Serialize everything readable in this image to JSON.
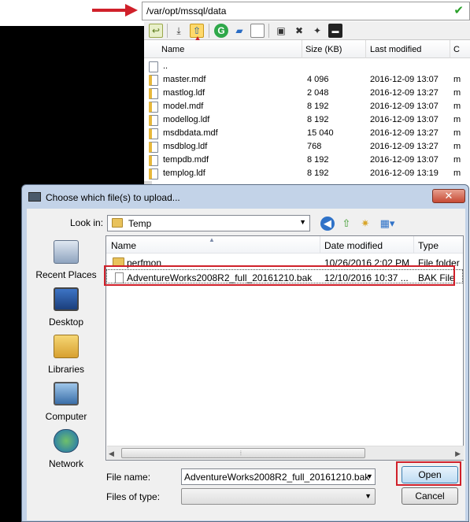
{
  "remote": {
    "path": "/var/opt/mssql/data",
    "columns": [
      "Name",
      "Size (KB)",
      "Last modified",
      "C"
    ],
    "parent_label": "..",
    "files": [
      {
        "name": "master.mdf",
        "size": "4 096",
        "modified": "2016-12-09 13:07",
        "extra": "m"
      },
      {
        "name": "mastlog.ldf",
        "size": "2 048",
        "modified": "2016-12-09 13:27",
        "extra": "m"
      },
      {
        "name": "model.mdf",
        "size": "8 192",
        "modified": "2016-12-09 13:07",
        "extra": "m"
      },
      {
        "name": "modellog.ldf",
        "size": "8 192",
        "modified": "2016-12-09 13:07",
        "extra": "m"
      },
      {
        "name": "msdbdata.mdf",
        "size": "15 040",
        "modified": "2016-12-09 13:27",
        "extra": "m"
      },
      {
        "name": "msdblog.ldf",
        "size": "768",
        "modified": "2016-12-09 13:27",
        "extra": "m"
      },
      {
        "name": "tempdb.mdf",
        "size": "8 192",
        "modified": "2016-12-09 13:07",
        "extra": "m"
      },
      {
        "name": "templog.ldf",
        "size": "8 192",
        "modified": "2016-12-09 13:19",
        "extra": "m"
      }
    ]
  },
  "dialog": {
    "title": "Choose which file(s) to upload...",
    "close_glyph": "✕",
    "look_in_label": "Look in:",
    "look_in_value": "Temp",
    "places": [
      "Recent Places",
      "Desktop",
      "Libraries",
      "Computer",
      "Network"
    ],
    "columns": [
      "Name",
      "Date modified",
      "Type"
    ],
    "files": [
      {
        "name": "perfmon",
        "modified": "10/26/2016 2:02 PM",
        "type": "File folder"
      },
      {
        "name": "AdventureWorks2008R2_full_20161210.bak",
        "modified": "12/10/2016 10:37 ...",
        "type": "BAK File"
      }
    ],
    "file_name_label": "File name:",
    "file_name_value": "AdventureWorks2008R2_full_20161210.bak",
    "files_of_type_label": "Files of type:",
    "files_of_type_value": "",
    "open_label": "Open",
    "cancel_label": "Cancel"
  },
  "colors": {
    "highlight": "#d0202a",
    "arrow": "#d0202a"
  }
}
